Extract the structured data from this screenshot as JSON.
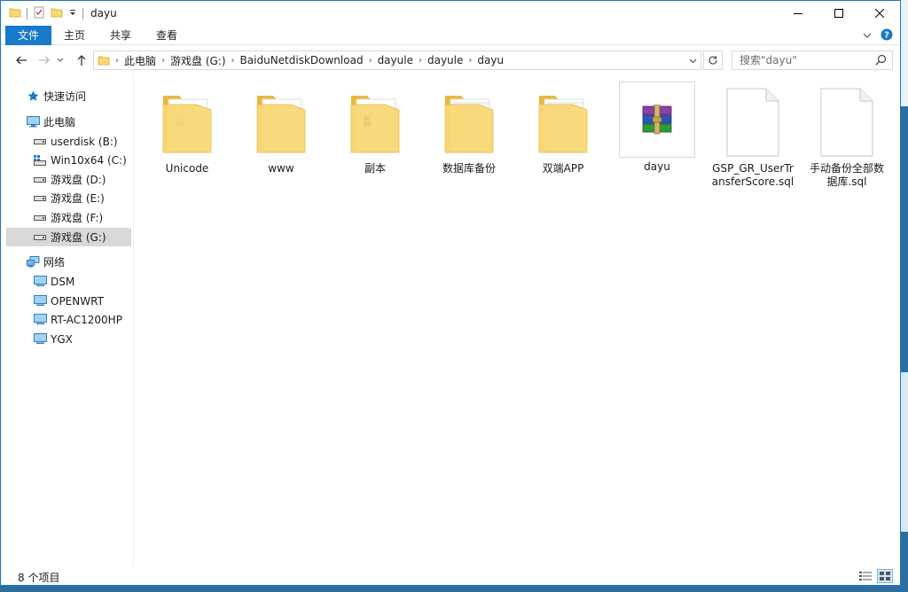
{
  "window": {
    "title": "dayu"
  },
  "ribbon": {
    "tabs": [
      "文件",
      "主页",
      "共享",
      "查看"
    ]
  },
  "address": {
    "crumbs": [
      "此电脑",
      "游戏盘 (G:)",
      "BaiduNetdiskDownload",
      "dayule",
      "dayule",
      "dayu"
    ]
  },
  "search": {
    "placeholder": "搜索\"dayu\""
  },
  "sidebar": {
    "quick_access": "快速访问",
    "this_pc": "此电脑",
    "drives": [
      {
        "label": "userdisk (B:)"
      },
      {
        "label": "Win10x64 (C:)"
      },
      {
        "label": "游戏盘 (D:)"
      },
      {
        "label": "游戏盘 (E:)"
      },
      {
        "label": "游戏盘 (F:)"
      },
      {
        "label": "游戏盘 (G:)",
        "selected": true
      }
    ],
    "network": "网络",
    "network_items": [
      {
        "label": "DSM"
      },
      {
        "label": "OPENWRT"
      },
      {
        "label": "RT-AC1200HP"
      },
      {
        "label": "YGX"
      }
    ]
  },
  "files": [
    {
      "name": "Unicode",
      "type": "folder",
      "icon": "folder-icon"
    },
    {
      "name": "www",
      "type": "folder",
      "icon": "folder-icon"
    },
    {
      "name": "副本",
      "type": "folder",
      "icon": "folder-icon"
    },
    {
      "name": "数据库备份",
      "type": "folder",
      "icon": "folder-icon"
    },
    {
      "name": "双端APP",
      "type": "folder",
      "icon": "folder-icon"
    },
    {
      "name": "dayu",
      "type": "archive",
      "icon": "winrar-archive-icon"
    },
    {
      "name": "GSP_GR_UserTransferScore.sql",
      "type": "file",
      "icon": "document-icon"
    },
    {
      "name": "手动备份全部数据库.sql",
      "type": "file",
      "icon": "document-icon"
    }
  ],
  "status": {
    "item_count": "8 个项目"
  },
  "colors": {
    "accent": "#1979ca",
    "folder": "#f8d775",
    "selection": "#d9d9d9"
  }
}
